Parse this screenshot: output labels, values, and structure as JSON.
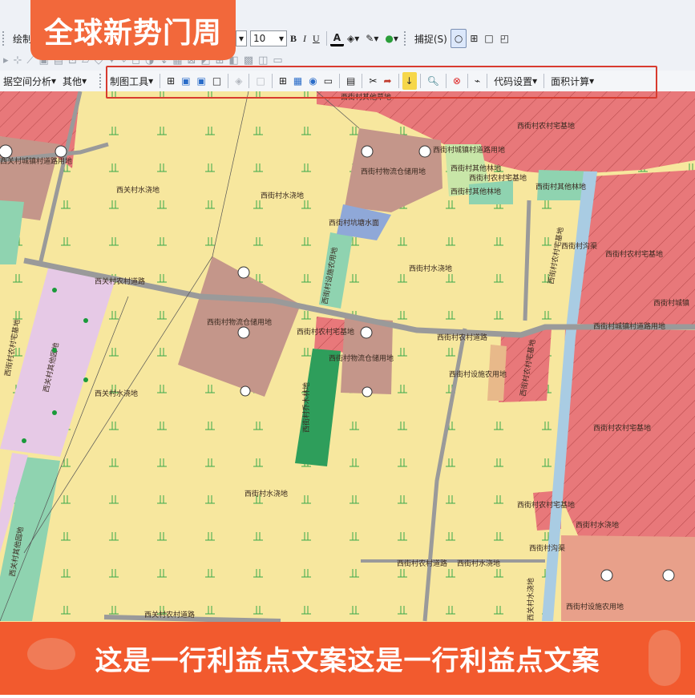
{
  "brand": {
    "text": "全球新势门周"
  },
  "banner": {
    "text": "这是一行利益点文案这是一行利益点文案"
  },
  "toolbar_top": {
    "draw_label": "绘制",
    "font_size": "10",
    "bold": "B",
    "italic": "I",
    "underline": "U",
    "font_color": "A",
    "snap_label": "捕捉(S)"
  },
  "toolbar_mid": {
    "spatial_analysis": "据空间分析",
    "other": "其他"
  },
  "toolbar_carto": {
    "carto_tools": "制图工具",
    "code_settings": "代码设置",
    "area_calc": "面积计算"
  },
  "map": {
    "labels": [
      "西街村农村宅基地",
      "西街村其他草地",
      "西街村城镇村道路用地",
      "西街村物流仓储用地",
      "西街村其他林地",
      "西街村农村宅基地",
      "西街村其他林地",
      "西关村水浇地",
      "西街村水浇地",
      "西街村坑塘水面",
      "西街村其他林地",
      "西街村沟渠",
      "西街村农村宅基地",
      "西街村水浇地",
      "西关村农村道路",
      "西街村物流仓储用地",
      "西街村农村宅基地",
      "西街村农村道路",
      "西街村物流仓储用地",
      "西街村设施农用地",
      "西街村农村宅基地",
      "西街村乔木林地",
      "西关村水浇地",
      "西街村农村宅基地",
      "西街村水浇地",
      "西街村农村宅基地",
      "西街村水浇地",
      "西街村沟渠",
      "西街村农村道路",
      "西街村水浇地",
      "西街村设施农用地",
      "西街村设施农用地",
      "西关村其他园地",
      "西关村其他园地",
      "西关村农村道路",
      "西街村城镇村道路用地",
      "西关村城镇村道路用地",
      "西街村农村宅基地",
      "西关村水浇地",
      "西街村城镇",
      "西街村农村宅基地"
    ]
  },
  "colors": {
    "toolbar_bg": "#eef1f6",
    "farmland": "#f7e79e",
    "homestead": "#e8787a",
    "warehouse": "#c4968a",
    "forest": "#2e9e5b",
    "grass": "#c8e6a8",
    "orchard": "#e6c9e6",
    "water": "#a9cce3",
    "road": "#9a9a9a",
    "brand": "#f2683b",
    "banner": "#f25a2e",
    "highlight": "#d83b2f"
  }
}
